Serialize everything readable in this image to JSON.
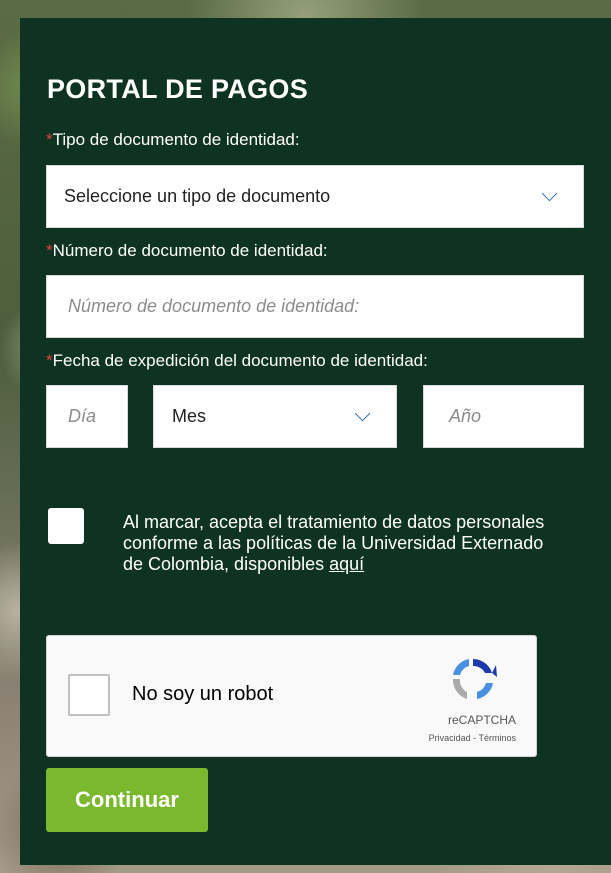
{
  "form": {
    "title": "PORTAL DE PAGOS",
    "required_mark": "*",
    "doc_type_label": "Tipo de documento de identidad:",
    "doc_type_value": "Seleccione un tipo de documento",
    "doc_number_label": "Número de documento de identidad:",
    "doc_number_placeholder": "Número de documento de identidad:",
    "issue_date_label": "Fecha de expedición del documento de identidad:",
    "day_placeholder": "Día",
    "month_value": "Mes",
    "year_placeholder": "Año",
    "consent_text": "Al marcar, acepta el tratamiento de datos personales conforme a las políticas de la Universidad Externado de Colombia, disponibles",
    "consent_link": "aquí",
    "continue_label": "Continuar"
  },
  "captcha": {
    "label": "No soy un robot",
    "brand": "reCAPTCHA",
    "links": "Privacidad - Términos"
  },
  "colors": {
    "panel": "#0f3322",
    "required": "#e0443c",
    "button": "#7ab82e",
    "chevron": "#3a6fb0"
  },
  "icons": [
    "chevron-down-icon",
    "recaptcha-logo-icon"
  ]
}
